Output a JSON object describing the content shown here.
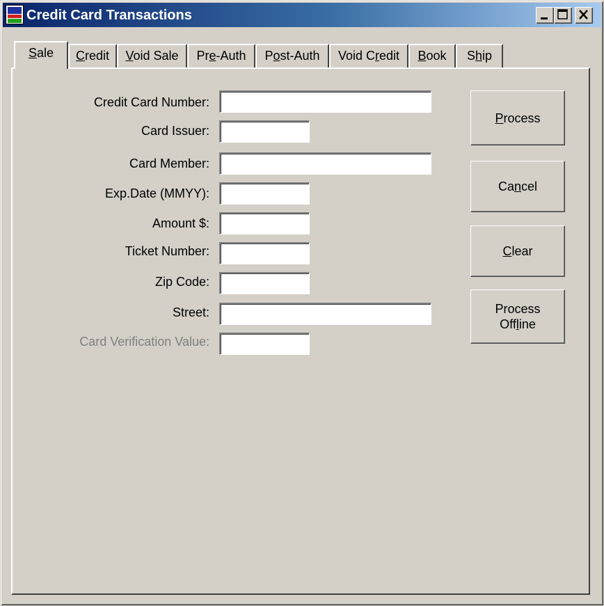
{
  "window": {
    "title": "Credit Card Transactions",
    "title_bar_colors": [
      "#0a246a",
      "#a6caf0"
    ]
  },
  "tabs": [
    {
      "pre": "",
      "key": "S",
      "post": "ale",
      "active": true
    },
    {
      "pre": "",
      "key": "C",
      "post": "redit"
    },
    {
      "pre": "",
      "key": "V",
      "post": "oid Sale"
    },
    {
      "pre": "Pr",
      "key": "e",
      "post": "-Auth"
    },
    {
      "pre": "P",
      "key": "o",
      "post": "st-Auth"
    },
    {
      "pre": "Void C",
      "key": "r",
      "post": "edit"
    },
    {
      "pre": "",
      "key": "B",
      "post": "ook"
    },
    {
      "pre": "S",
      "key": "h",
      "post": "ip"
    }
  ],
  "form": {
    "card_number": {
      "label": "Credit Card Number:",
      "value": ""
    },
    "card_issuer": {
      "label": "Card Issuer:",
      "value": ""
    },
    "card_member": {
      "label": "Card Member:",
      "value": ""
    },
    "exp_date": {
      "label": "Exp.Date (MMYY):",
      "value": ""
    },
    "amount": {
      "label": "Amount $:",
      "value": ""
    },
    "ticket_number": {
      "label": "Ticket Number:",
      "value": ""
    },
    "zip_code": {
      "label": "Zip Code:",
      "value": ""
    },
    "street": {
      "label": "Street:",
      "value": ""
    },
    "cvv": {
      "label": "Card Verification Value:",
      "value": "",
      "disabled": true
    }
  },
  "buttons": {
    "process": {
      "pre": "",
      "key": "P",
      "post": "rocess"
    },
    "cancel": {
      "pre": "Ca",
      "key": "n",
      "post": "cel"
    },
    "clear": {
      "pre": "",
      "key": "C",
      "post": "lear"
    },
    "process_offline": {
      "line1": "Process",
      "line2_pre": "Off",
      "line2_key": "l",
      "line2_post": "ine"
    }
  }
}
